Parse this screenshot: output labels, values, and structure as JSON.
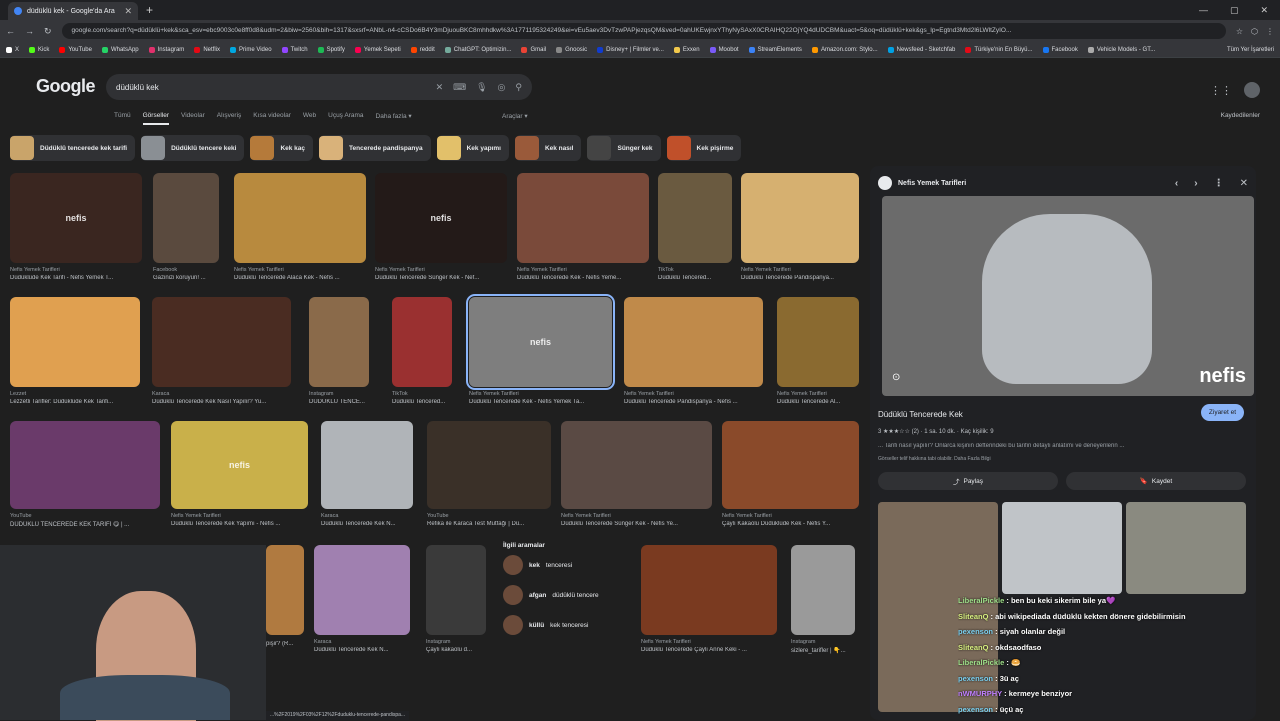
{
  "browser": {
    "tab_title": "düdüklü kek - Google'da Ara",
    "url": "google.com/search?q=düdüklü+kek&sca_esv=ebc9003c0e8ff0d8&udm=2&biw=2560&bih=1317&sxsrf=ANbL-n4-cCSDo6B4Y3mDjuouBKC8mhhdkw%3A1771195324249&ei=vEu5aev3DvTzwPAPjezqsQM&ved=0ahUKEwjnxYThyNySAxX0CRAIHQ22OjYQ4dUDCBM&uact=5&oq=düdüklü+kek&gs_lp=Egtnd3Mtd2l6LWltZyIO...",
    "bookmarks": [
      "X",
      "Kick",
      "YouTube",
      "WhatsApp",
      "Instagram",
      "Netflix",
      "Prime Video",
      "Twitch",
      "Spotify",
      "Yemek Sepeti",
      "reddit",
      "ChatGPT: Optimizin...",
      "Gmail",
      "Gnoosic",
      "Disney+ | Filmler ve...",
      "Exxen",
      "Moobot",
      "StreamElements",
      "Amazon.com: Stylo...",
      "Newsfeed - Sketchfab",
      "Türkiye'nin En Büyü...",
      "Facebook",
      "Vehicle Models - GT..."
    ],
    "all_bookmarks": "Tüm Yer İşaretleri",
    "status_url": "...%2F2019%2F03%2F12%2Fduduklu-tencerede-pandispa..."
  },
  "search": {
    "logo": "Google",
    "query": "düdüklü kek",
    "tabs": [
      "Tümü",
      "Görseller",
      "Videolar",
      "Alışveriş",
      "Kısa videolar",
      "Web",
      "Uçuş Arama",
      "Daha fazla ▾"
    ],
    "tools": "Araçlar ▾",
    "saved": "Kaydedilenler"
  },
  "chips": [
    {
      "label": "Düdüklü tencerede kek tarifi",
      "color": "#c9a46a"
    },
    {
      "label": "Düdüklü tencere keki",
      "color": "#8a8f94"
    },
    {
      "label": "Kek kaç",
      "color": "#b57a3a"
    },
    {
      "label": "Tencerede pandispanya",
      "color": "#d9b27a"
    },
    {
      "label": "Kek yapımı",
      "color": "#e2c06a"
    },
    {
      "label": "Kek nasıl",
      "color": "#9a5a3a"
    },
    {
      "label": "Sünger kek",
      "color": "#444"
    },
    {
      "label": "Kek pişirme",
      "color": "#c0502a"
    }
  ],
  "results": [
    {
      "src": "Nefis Yemek Tarifleri",
      "title": "Düdüklüde Kek Tarifi - Nefis Yemek T...",
      "color": "#3a2620",
      "badge": "nefis"
    },
    {
      "src": "Facebook",
      "title": "Gazinizi koruyun! ...",
      "color": "#5a4a3e",
      "badge": ""
    },
    {
      "src": "Nefis Yemek Tarifleri",
      "title": "Düdüklü Tencerede Alaca Kek - Nefis ...",
      "color": "#b88a3e",
      "badge": ""
    },
    {
      "src": "Nefis Yemek Tarifleri",
      "title": "Düdüklü Tencerede Sünger Kek - Nef...",
      "color": "#231a18",
      "badge": "nefis"
    },
    {
      "src": "Nefis Yemek Tarifleri",
      "title": "Düdüklü Tencerede Kek - Nefis Yeme...",
      "color": "#7a4a3a",
      "badge": ""
    },
    {
      "src": "TikTok",
      "title": "Düdüklü Tencered...",
      "color": "#6a5a40",
      "badge": ""
    },
    {
      "src": "Nefis Yemek Tarifleri",
      "title": "Düdüklü Tencerede Pandispanya...",
      "color": "#d6b070",
      "badge": ""
    },
    {
      "src": "Lezzet",
      "title": "Lezzetli Tarifler: Düdüklüde Kek Tarifi...",
      "color": "#e0a050",
      "badge": ""
    },
    {
      "src": "Karaca",
      "title": "Düdüklü Tencerede Kek Nasıl Yapılır? Yu...",
      "color": "#4a2c22",
      "badge": ""
    },
    {
      "src": "Instagram",
      "title": "DÜDÜKLÜ TENCE...",
      "color": "#8a6a4a",
      "badge": ""
    },
    {
      "src": "TikTok",
      "title": "Düdüklü Tencered...",
      "color": "#9a3030",
      "badge": ""
    },
    {
      "src": "Nefis Yemek Tarifleri",
      "title": "Düdüklü Tencerede Kek - Nefis Yemek Ta...",
      "color": "#7e7e7e",
      "badge": "nefis"
    },
    {
      "src": "Nefis Yemek Tarifleri",
      "title": "Düdüklü Tencerede Pandispanya - Nefis ...",
      "color": "#c08a4a",
      "badge": ""
    },
    {
      "src": "Nefis Yemek Tarifleri",
      "title": "Düdüklü Tencerede Al...",
      "color": "#8a6a30",
      "badge": ""
    },
    {
      "src": "YouTube",
      "title": "DÜDÜKLÜ TENCEREDE KEK TARİFİ 😋 | ...",
      "color": "#6a3a6a",
      "badge": ""
    },
    {
      "src": "Nefis Yemek Tarifleri",
      "title": "Düdüklü Tencerede Kek Yapımı - Nefis ...",
      "color": "#c9b04a",
      "badge": "nefis"
    },
    {
      "src": "Karaca",
      "title": "Düdüklü Tencerede Kek N...",
      "color": "#b0b4b8",
      "badge": ""
    },
    {
      "src": "YouTube",
      "title": "Refika ile Karaca Test Mutfağı | Dü...",
      "color": "#3a3028",
      "badge": ""
    },
    {
      "src": "Nefis Yemek Tarifleri",
      "title": "Düdüklü Tencerede Sünger Kek - Nefis Ye...",
      "color": "#5a4a44",
      "badge": ""
    },
    {
      "src": "Nefis Yemek Tarifleri",
      "title": "Çaylı Kakaolu Düdüklüde Kek - Nefis Y...",
      "color": "#8a4a2a",
      "badge": ""
    },
    {
      "src": "",
      "title": "pişir? (R...",
      "color": "#b07a40",
      "badge": ""
    },
    {
      "src": "Karaca",
      "title": "Düdüklü Tencerede Kek N...",
      "color": "#a080b0",
      "badge": ""
    },
    {
      "src": "Instagram",
      "title": "Çaylı kakaolu d...",
      "color": "#3a3a3a",
      "badge": ""
    },
    {
      "src": "Nefis Yemek Tarifleri",
      "title": "Düdüklü Tencerede Çaylı Anne Keki - ...",
      "color": "#7a3a20",
      "badge": ""
    },
    {
      "src": "Instagram",
      "title": "sizlere_tarifler | 👇...",
      "color": "#9a9a9a",
      "badge": ""
    }
  ],
  "related": {
    "heading": "İlgili aramalar",
    "items": [
      {
        "bold": "kek",
        "text": "tenceresi"
      },
      {
        "bold": "afgan",
        "text": "düdüklü tencere"
      },
      {
        "bold": "küllü",
        "text": "kek tenceresi"
      }
    ]
  },
  "panel": {
    "source": "Nefis Yemek Tarifleri",
    "title": "Düdüklü Tencerede Kek",
    "visit": "Ziyaret et",
    "rating": "3 ★★★☆☆ (2) · 1 sa. 10 dk. · Kaç kişilik: 9",
    "desc": "... Tarifi nasıl yapılır? Onlarca kişinin defterindeki bu tarifin detaylı anlatımı ve deneyenlerin ...",
    "note": "Görseller telif hakkına tabi olabilir. Daha Fazla Bilgi",
    "share": "Paylaş",
    "save": "Kaydet",
    "watermark": "nefis",
    "thumb_colors": [
      "#7a6a5a",
      "#c0c4c8",
      "#8a8a80"
    ]
  },
  "chat": [
    {
      "user": "LiberalPickle",
      "msg": "ben bu keki sikerim bile ya💜",
      "color": "#9fe08a"
    },
    {
      "user": "SliteanQ",
      "msg": "abi wikipediada düdüklü kekten dönere gidebilirmisin",
      "color": "#d8f080"
    },
    {
      "user": "pexenson",
      "msg": "siyah olanlar değil",
      "color": "#7ad0f0"
    },
    {
      "user": "SliteanQ",
      "msg": "okdsaodfaso",
      "color": "#d8f080"
    },
    {
      "user": "LiberalPickle",
      "msg": "🥯",
      "color": "#9fe08a"
    },
    {
      "user": "pexenson",
      "msg": "3ü aç",
      "color": "#7ad0f0"
    },
    {
      "user": "nWMURPHY",
      "msg": "kermeye benziyor",
      "color": "#c080ff"
    },
    {
      "user": "pexenson",
      "msg": "üçü aç",
      "color": "#7ad0f0"
    }
  ]
}
